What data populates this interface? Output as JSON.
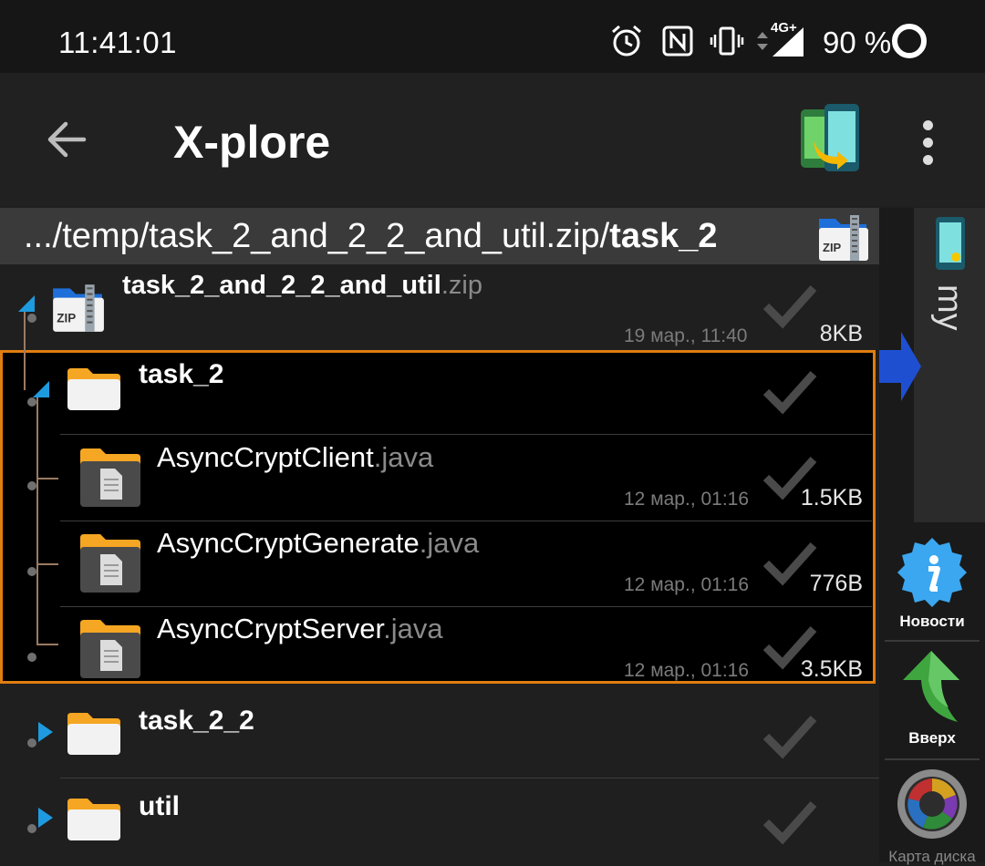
{
  "status": {
    "time": "11:41:01",
    "battery": "90 %",
    "network": "4G+",
    "icons": [
      "alarm-icon",
      "nfc-icon",
      "vibrate-icon",
      "data-arrows-icon",
      "signal-icon",
      "battery-ring-icon"
    ]
  },
  "appbar": {
    "title": "X-plore",
    "back_icon": "arrow-back-icon",
    "logo_icon": "dual-pane-logo-icon",
    "menu_icon": "more-vert-icon"
  },
  "path": {
    "prefix": ".../temp/task_2_and_2_2_and_util.zip/",
    "current": "task_2",
    "icon": "zip-archive-icon",
    "zip_label": "ZIP"
  },
  "rows": [
    {
      "name": "task_2_and_2_2_and_util",
      "ext": ".zip",
      "date": "19 мар., 11:40",
      "size": "8KB",
      "type": "zip"
    },
    {
      "name": "task_2",
      "ext": "",
      "date": "",
      "size": "",
      "type": "folder-open"
    },
    {
      "name": "AsyncCryptClient",
      "ext": ".java",
      "date": "12 мар., 01:16",
      "size": "1.5KB",
      "type": "file"
    },
    {
      "name": "AsyncCryptGenerate",
      "ext": ".java",
      "date": "12 мар., 01:16",
      "size": "776B",
      "type": "file"
    },
    {
      "name": "AsyncCryptServer",
      "ext": ".java",
      "date": "12 мар., 01:16",
      "size": "3.5KB",
      "type": "file"
    },
    {
      "name": "task_2_2",
      "ext": "",
      "date": "",
      "size": "",
      "type": "folder"
    },
    {
      "name": "util",
      "ext": "",
      "date": "",
      "size": "",
      "type": "folder"
    }
  ],
  "right_panel": {
    "pane_label": "my",
    "tools": [
      {
        "label": "Новости",
        "icon": "info-badge-icon"
      },
      {
        "label": "Вверх",
        "icon": "arrow-up-green-icon"
      },
      {
        "label": "Карта диска",
        "icon": "disk-map-icon"
      }
    ]
  },
  "colors": {
    "selection_border": "#e07d10",
    "folder": "#f5a623",
    "accent_blue": "#1e88e5",
    "copy_arrow": "#1f4fd1"
  }
}
